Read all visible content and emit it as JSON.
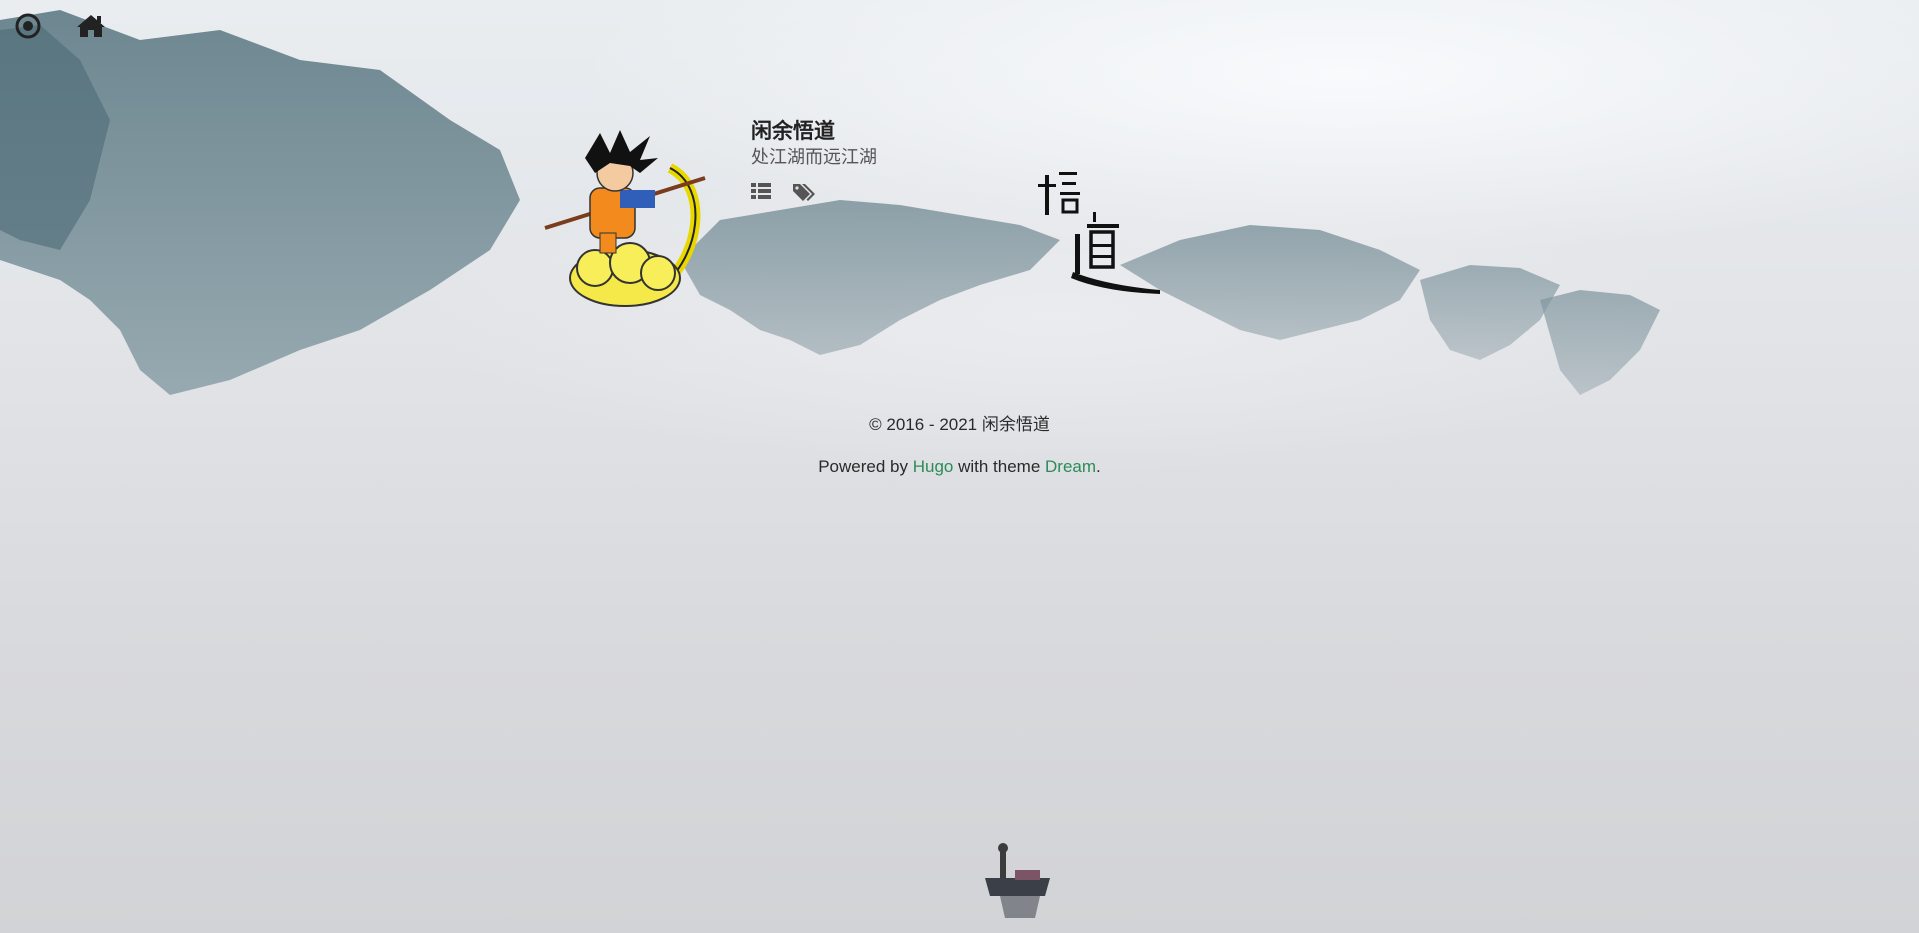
{
  "nav": {
    "menu_icon": "circle-target-icon",
    "home_icon": "home-icon"
  },
  "site": {
    "title": "闲余悟道",
    "subtitle": "处江湖而远江湖",
    "links": [
      {
        "icon": "list-icon"
      },
      {
        "icon": "tags-icon"
      }
    ]
  },
  "footer": {
    "copyright": "© 2016 - 2021 闲余悟道",
    "powered_prefix": "Powered by ",
    "hugo_label": "Hugo",
    "theme_text": " with theme ",
    "dream_label": "Dream",
    "period": "."
  },
  "colors": {
    "link": "#2c8c57",
    "text": "#2a2a2a"
  }
}
